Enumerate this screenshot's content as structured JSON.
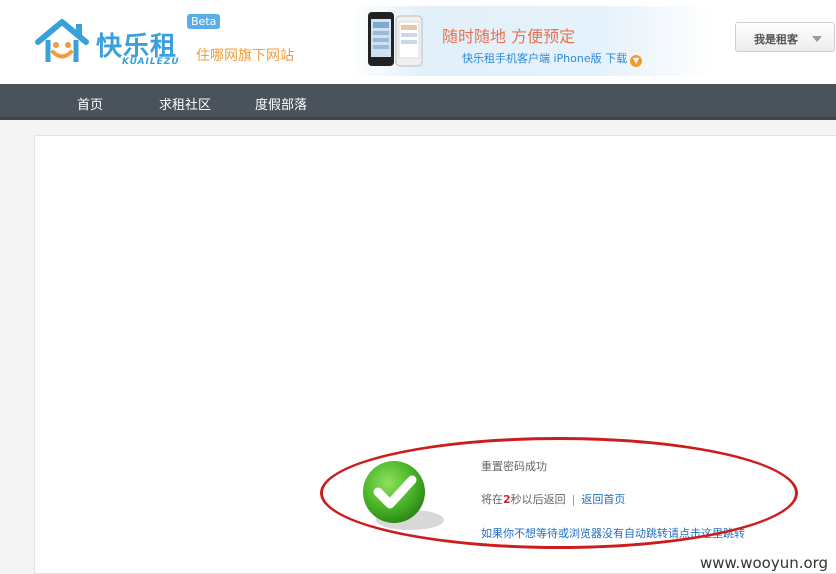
{
  "header": {
    "logo_name": "快乐租",
    "logo_sub": "KUAILEZU",
    "beta_badge": "Beta",
    "slogan": "住哪网旗下网站",
    "promo_title": "随时随地 方便预定",
    "promo_link": "快乐租手机客户端 iPhone版 下载",
    "user_menu": "我是租客"
  },
  "nav": {
    "items": [
      "首页",
      "求租社区",
      "度假部落"
    ]
  },
  "message": {
    "title": "重置密码成功",
    "countdown_prefix": "将在",
    "countdown_seconds": "2",
    "countdown_suffix": "秒以后返回",
    "separator": "|",
    "home_link": "返回首页",
    "jump_link": "如果你不想等待或浏览器没有自动跳转请点击这里跳转"
  },
  "watermark": "www.wooyun.org",
  "colors": {
    "brand_blue": "#3aa0dc",
    "brand_orange": "#f19b3a",
    "nav_bg": "#4a525b",
    "link": "#1e6fc4",
    "highlight_red": "#cc1c1c",
    "countdown_red": "#d9232e",
    "check_green": "#4cb82a"
  },
  "icons": {
    "logo": "house-smile-icon",
    "promo": "phone-icon",
    "download": "download-arrow-icon",
    "dropdown": "caret-down-icon",
    "success": "checkmark-icon"
  }
}
